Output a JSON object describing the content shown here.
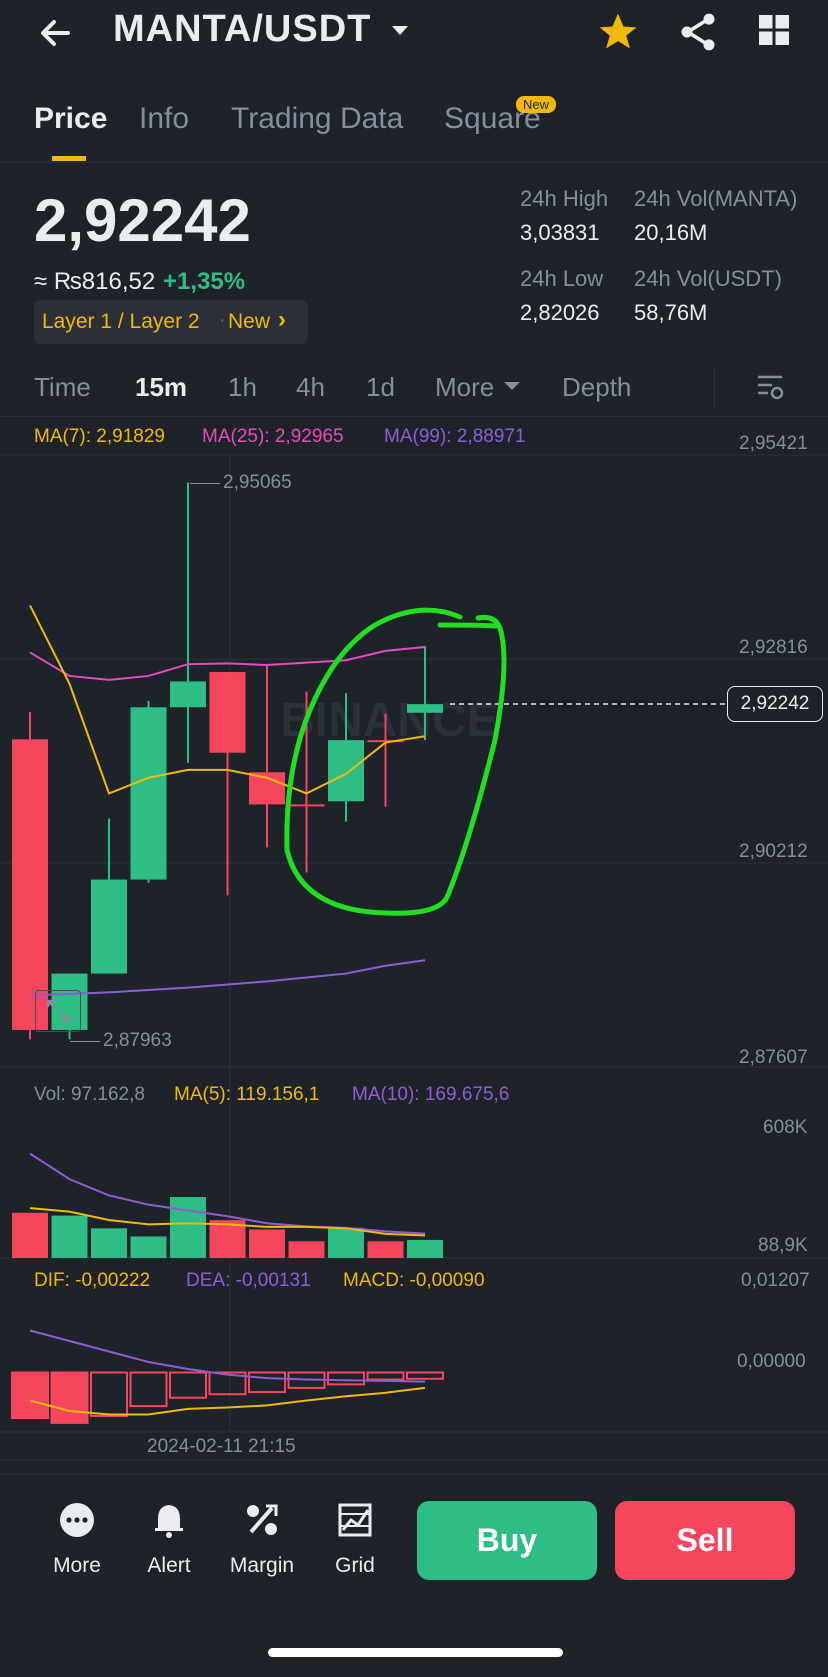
{
  "header": {
    "pair": "MANTA/USDT"
  },
  "tabs": [
    {
      "label": "Price",
      "active": true
    },
    {
      "label": "Info",
      "active": false
    },
    {
      "label": "Trading Data",
      "active": false
    },
    {
      "label": "Square",
      "active": false,
      "badge": "New"
    }
  ],
  "ticker": {
    "last_price": "2,92242",
    "fiat_value": "≈ ₨816,52",
    "change": "+1,35%",
    "tag_text": "Layer 1 / Layer 2",
    "tag_new": "New",
    "tag_arrow": "›",
    "stats": [
      {
        "label": "24h High",
        "value": "3,03831"
      },
      {
        "label": "24h Vol(MANTA)",
        "value": "20,16M"
      },
      {
        "label": "24h Low",
        "value": "2,82026"
      },
      {
        "label": "24h Vol(USDT)",
        "value": "58,76M"
      }
    ]
  },
  "intervals": [
    {
      "label": "Time",
      "active": false
    },
    {
      "label": "15m",
      "active": true
    },
    {
      "label": "1h",
      "active": false
    },
    {
      "label": "4h",
      "active": false
    },
    {
      "label": "1d",
      "active": false
    },
    {
      "label": "More",
      "active": false
    },
    {
      "label": "Depth",
      "active": false
    }
  ],
  "indicators": {
    "ma7": "MA(7): 2,91829",
    "ma25": "MA(25): 2,92965",
    "ma99": "MA(99): 2,88971",
    "vol": "Vol: 97.162,8",
    "vol_ma5": "MA(5): 119.156,1",
    "vol_ma10": "MA(10): 169.675,6",
    "dif": "DIF: -0,00222",
    "dea": "DEA: -0,00131",
    "macd": "MACD: -0,00090"
  },
  "price_axis": [
    "2,95421",
    "2,92816",
    "2,90212",
    "2,87607"
  ],
  "current_price_label": "2,92242",
  "high_marker": "2,95065",
  "low_marker": "2,87963",
  "volume_axis": [
    "608K",
    "88,9K"
  ],
  "macd_axis": [
    "0,01207",
    "0,00000"
  ],
  "time_label": "2024-02-11 21:15",
  "watermark": "BINANCE",
  "bottom_bar": {
    "items": [
      {
        "label": "More",
        "icon": "more-dots-icon"
      },
      {
        "label": "Alert",
        "icon": "bell-icon"
      },
      {
        "label": "Margin",
        "icon": "margin-icon"
      },
      {
        "label": "Grid",
        "icon": "grid-chart-icon"
      }
    ],
    "buy": "Buy",
    "sell": "Sell"
  },
  "colors": {
    "background": "#1e2329",
    "up": "#2ebd85",
    "down": "#f6465d",
    "accent": "#f0b90b",
    "ma25": "#e84bc1",
    "ma99": "#8f5cd6",
    "annotation": "#22dd22"
  },
  "chart_data": {
    "type": "candlestick",
    "y_range": [
      2.87607,
      2.95421
    ],
    "candles": [
      {
        "o": 2.9179,
        "h": 2.9214,
        "l": 2.8796,
        "c": 2.8808,
        "dir": "down"
      },
      {
        "o": 2.8808,
        "h": 2.8851,
        "l": 2.8796,
        "c": 2.888,
        "dir": "up"
      },
      {
        "o": 2.888,
        "h": 2.9078,
        "l": 2.888,
        "c": 2.9,
        "dir": "up"
      },
      {
        "o": 2.9,
        "h": 2.9228,
        "l": 2.8996,
        "c": 2.922,
        "dir": "up"
      },
      {
        "o": 2.922,
        "h": 2.9507,
        "l": 2.9149,
        "c": 2.9253,
        "dir": "up"
      },
      {
        "o": 2.9265,
        "h": 2.9265,
        "l": 2.898,
        "c": 2.9162,
        "dir": "down"
      },
      {
        "o": 2.9137,
        "h": 2.9274,
        "l": 2.9041,
        "c": 2.9096,
        "dir": "down"
      },
      {
        "o": 2.9096,
        "h": 2.924,
        "l": 2.9009,
        "c": 2.9096,
        "dir": "down"
      },
      {
        "o": 2.91,
        "h": 2.9238,
        "l": 2.9074,
        "c": 2.9178,
        "dir": "up"
      },
      {
        "o": 2.9178,
        "h": 2.9212,
        "l": 2.9093,
        "c": 2.9178,
        "dir": "down"
      },
      {
        "o": 2.9213,
        "h": 2.9298,
        "l": 2.9178,
        "c": 2.9224,
        "dir": "up"
      }
    ],
    "ma7": [
      2.935,
      2.925,
      2.911,
      2.913,
      2.914,
      2.914,
      2.913,
      2.911,
      2.9135,
      2.9175,
      2.9183
    ],
    "ma25": [
      2.929,
      2.926,
      2.9255,
      2.926,
      2.9275,
      2.9276,
      2.9274,
      2.9277,
      2.928,
      2.9292,
      2.9297
    ],
    "ma99": [
      2.8852,
      2.8854,
      2.8856,
      2.8859,
      2.8862,
      2.8866,
      2.887,
      2.8875,
      2.888,
      2.889,
      2.8897
    ],
    "volume": [
      195000,
      183000,
      128000,
      93000,
      263000,
      163000,
      123000,
      72000,
      130000,
      72000,
      78000
    ],
    "volume_range": [
      0,
      608000
    ],
    "volume_ma5": [
      215000,
      200000,
      164000,
      145000,
      150000,
      145000,
      134000,
      134000,
      128000,
      104000,
      97000
    ],
    "volume_ma10": [
      450000,
      340000,
      270000,
      230000,
      205000,
      180000,
      150000,
      136000,
      130000,
      115000,
      105000
    ],
    "macd_hist": [
      -0.0065,
      -0.0072,
      -0.0062,
      -0.0048,
      -0.0036,
      -0.0031,
      -0.0028,
      -0.0022,
      -0.0017,
      -0.001,
      -0.0009
    ],
    "macd_range": [
      -0.0085,
      0.01207
    ],
    "dif": [
      -0.004,
      -0.0055,
      -0.006,
      -0.006,
      -0.0052,
      -0.005,
      -0.0047,
      -0.004,
      -0.0034,
      -0.0029,
      -0.0022
    ],
    "dea": [
      0.006,
      0.0045,
      0.003,
      0.0015,
      0.0005,
      -0.0003,
      -0.0008,
      -0.001,
      -0.0011,
      -0.0012,
      -0.0013
    ]
  }
}
